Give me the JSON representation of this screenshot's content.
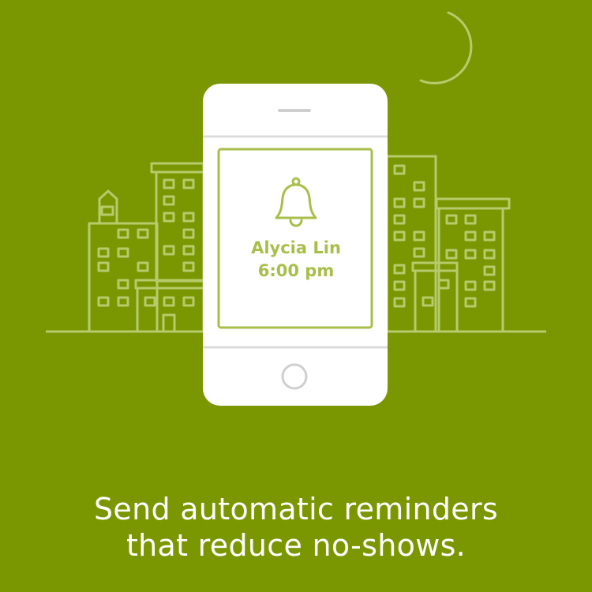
{
  "colors": {
    "background": "#7a9600",
    "outline": "#b6cc6c",
    "phone": "#ffffff",
    "accent": "#a7bf4a"
  },
  "icons": [
    "moon-icon",
    "bell-icon",
    "home-button-icon"
  ],
  "notification": {
    "name": "Alycia Lin",
    "time": "6:00 pm"
  },
  "caption": {
    "line1": "Send automatic reminders",
    "line2": "that reduce no-shows."
  }
}
